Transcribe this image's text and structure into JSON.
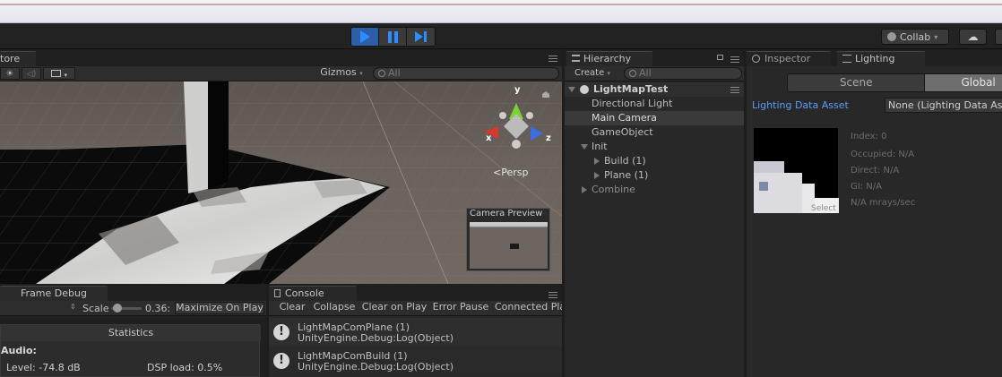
{
  "toolbar": {
    "collab_label": "Collab",
    "collab_chevron": "▾",
    "cloud_icon": "☁"
  },
  "scene": {
    "tab_label": "tore",
    "gizmos_label": "Gizmos",
    "gizmos_chevron": "▾",
    "search_placeholder": "All",
    "dropdown_chevron": "▾",
    "axis_y": "y",
    "axis_x": "x",
    "axis_z": "z",
    "persp_label": "Persp",
    "camera_preview_title": "Camera Preview"
  },
  "game": {
    "tab_label": "Frame Debug",
    "scale_label": "Scale",
    "scale_value": "0.36:",
    "scale_fraction": 0.1,
    "maximize_label": "Maximize On Play",
    "statistics_title": "Statistics",
    "audio_heading": "Audio:",
    "level_label": "Level: -74.8 dB",
    "dsp_label": "DSP load: 0.5%"
  },
  "console": {
    "tab_label": "Console",
    "buttons": [
      "Clear",
      "Collapse",
      "Clear on Play",
      "Error Pause",
      "Connected Pla"
    ],
    "entries": [
      {
        "line1": "LightMapComPlane (1)",
        "line2": "UnityEngine.Debug:Log(Object)"
      },
      {
        "line1": "LightMapComBuild (1)",
        "line2": "UnityEngine.Debug:Log(Object)"
      }
    ],
    "warn_icon": "!"
  },
  "hierarchy": {
    "tab_label": "Hierarchy",
    "create_label": "Create",
    "create_chevron": "▾",
    "search_placeholder": "All",
    "scene_name": "LightMapTest",
    "items": [
      {
        "label": "Directional Light",
        "depth": 1,
        "expander": "none",
        "selected": false
      },
      {
        "label": "Main Camera",
        "depth": 1,
        "expander": "none",
        "selected": true
      },
      {
        "label": "GameObject",
        "depth": 1,
        "expander": "none",
        "selected": false
      },
      {
        "label": "Init",
        "depth": 1,
        "expander": "open",
        "selected": false
      },
      {
        "label": "Build (1)",
        "depth": 2,
        "expander": "closed",
        "selected": false
      },
      {
        "label": "Plane (1)",
        "depth": 2,
        "expander": "closed",
        "selected": false
      },
      {
        "label": "Combine",
        "depth": 1,
        "expander": "closed",
        "selected": false
      }
    ]
  },
  "inspector": {
    "tab_inspector": "Inspector",
    "tab_lighting": "Lighting",
    "seg_scene": "Scene",
    "seg_global": "Global",
    "lighting_asset_label": "Lighting Data Asset",
    "lighting_asset_value": "None (Lighting Data As",
    "select_label": "Select",
    "stats": [
      "Index: 0",
      "Occupied: N/A",
      "Direct: N/A",
      "GI: N/A",
      "N/A mrays/sec"
    ]
  },
  "colors": {
    "accent_blue": "#2d8cff",
    "link_blue": "#5b9bff",
    "selected_row": "#3a3a3a"
  }
}
